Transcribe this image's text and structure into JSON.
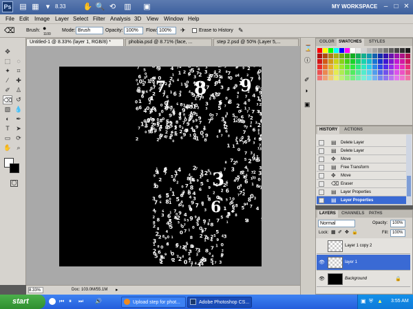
{
  "app": {
    "logo": "Ps",
    "zoom": "8.33",
    "workspace": "MY WORKSPACE",
    "window_buttons": [
      "–",
      "□",
      "✕"
    ]
  },
  "menu": [
    "File",
    "Edit",
    "Image",
    "Layer",
    "Select",
    "Filter",
    "Analysis",
    "3D",
    "View",
    "Window",
    "Help"
  ],
  "options": {
    "brush_label": "Brush:",
    "brush_size": "1100",
    "mode_label": "Mode:",
    "mode_value": "Brush",
    "opacity_label": "Opacity:",
    "opacity_value": "100%",
    "flow_label": "Flow:",
    "flow_value": "100%",
    "erase_history_label": "Erase to History"
  },
  "tabs": [
    {
      "label": "Untitled-1 @ 8.33% (layer 1, RGB/8) *",
      "active": true
    },
    {
      "label": "phobia.psd @ 8.71% (face, ...",
      "active": false
    },
    {
      "label": "step 2.psd @ 50% (Layer 5,...",
      "active": false
    }
  ],
  "canvas": {
    "background": "#000000",
    "big_digits": [
      "7",
      "8",
      "9",
      "3",
      "6"
    ]
  },
  "status": {
    "zoom": "8.33%",
    "doc": "Doc: 103.0M/55.1M"
  },
  "color_panel": {
    "tabs": [
      "COLOR",
      "SWATCHES",
      "STYLES"
    ],
    "active_tab": "SWATCHES"
  },
  "history_panel": {
    "tabs": [
      "HISTORY",
      "ACTIONS"
    ],
    "items": [
      {
        "label": "Delete Layer",
        "icon": "history-step-icon"
      },
      {
        "label": "Delete Layer",
        "icon": "history-step-icon"
      },
      {
        "label": "Move",
        "icon": "move-icon"
      },
      {
        "label": "Free Transform",
        "icon": "history-step-icon"
      },
      {
        "label": "Move",
        "icon": "move-icon"
      },
      {
        "label": "Eraser",
        "icon": "eraser-icon"
      },
      {
        "label": "Layer Properties",
        "icon": "history-step-icon"
      },
      {
        "label": "Layer Properties",
        "icon": "history-step-icon",
        "selected": true
      }
    ]
  },
  "layers_panel": {
    "tabs": [
      "LAYERS",
      "CHANNELS",
      "PATHS"
    ],
    "blend_mode": "Normal",
    "opacity_label": "Opacity:",
    "opacity_value": "100%",
    "lock_label": "Lock:",
    "fill_label": "Fill:",
    "fill_value": "100%",
    "layers": [
      {
        "name": "Layer 1 copy 2",
        "visible": false,
        "selected": false
      },
      {
        "name": "layer 1",
        "visible": true,
        "selected": true
      },
      {
        "name": "Background",
        "visible": true,
        "selected": false,
        "locked": true
      }
    ]
  },
  "taskbar": {
    "start": "start",
    "tasks": [
      "Upload step for phot...",
      "Adobe Photoshop CS..."
    ],
    "time": "3:55 AM"
  },
  "colors": {
    "selection": "#3a6ad4",
    "foreground": "#ffffff",
    "background_swatch": "#000000"
  }
}
